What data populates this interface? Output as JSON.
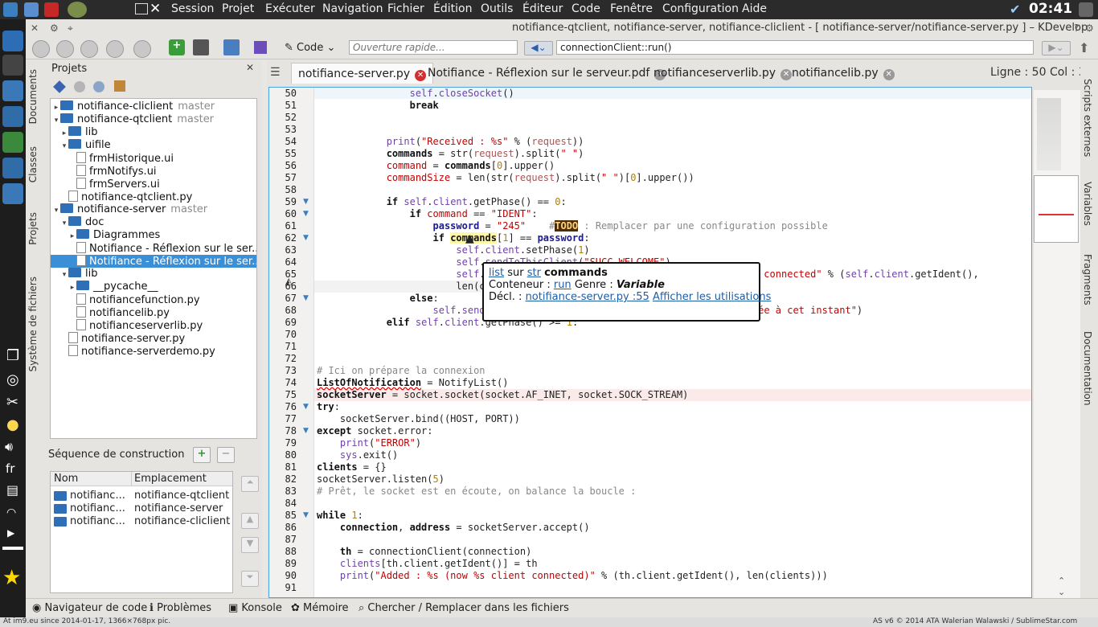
{
  "topbar": {
    "menus": [
      "Session",
      "Projet",
      "Exécuter",
      "Navigation",
      "Fichier",
      "Édition",
      "Outils",
      "Éditeur",
      "Code",
      "Fenêtre",
      "Configuration",
      "Aide"
    ],
    "clock": "02:41"
  },
  "window": {
    "title": "notifiance-qtclient, notifiance-server, notifiance-cliclient - [ notifiance-server/notifiance-server.py ] – KDevelop",
    "code_button": "Code",
    "quick_open_placeholder": "Ouverture rapide...",
    "context": "connectionClient::run()",
    "line_col": "Ligne : 50 Col : 35"
  },
  "left_tabs": [
    "Documents",
    "Classes",
    "Projets",
    "Système de fichiers"
  ],
  "projects": {
    "title": "Projets",
    "tree": [
      {
        "text": "notifiance-cliclient",
        "branch": "master",
        "type": "folder",
        "arrow": "▸",
        "indent": 0
      },
      {
        "text": "notifiance-qtclient",
        "branch": "master",
        "type": "folder",
        "arrow": "▾",
        "indent": 0
      },
      {
        "text": "lib",
        "branch": "",
        "type": "folder",
        "arrow": "▸",
        "indent": 1
      },
      {
        "text": "uifile",
        "branch": "",
        "type": "folder",
        "arrow": "▾",
        "indent": 1
      },
      {
        "text": "frmHistorique.ui",
        "branch": "",
        "type": "file",
        "arrow": "",
        "indent": 2
      },
      {
        "text": "frmNotifys.ui",
        "branch": "",
        "type": "file",
        "arrow": "",
        "indent": 2
      },
      {
        "text": "frmServers.ui",
        "branch": "",
        "type": "file",
        "arrow": "",
        "indent": 2
      },
      {
        "text": "notifiance-qtclient.py",
        "branch": "",
        "type": "file",
        "arrow": "",
        "indent": 1
      },
      {
        "text": "notifiance-server",
        "branch": "master",
        "type": "folder",
        "arrow": "▾",
        "indent": 0
      },
      {
        "text": "doc",
        "branch": "",
        "type": "folder",
        "arrow": "▾",
        "indent": 1
      },
      {
        "text": "Diagrammes",
        "branch": "",
        "type": "folder",
        "arrow": "▸",
        "indent": 2
      },
      {
        "text": "Notifiance - Réflexion sur le ser...",
        "branch": "",
        "type": "file",
        "arrow": "",
        "indent": 2
      },
      {
        "text": "Notifiance - Réflexion sur le ser...",
        "branch": "",
        "type": "file",
        "arrow": "",
        "indent": 2,
        "selected": true
      },
      {
        "text": "lib",
        "branch": "",
        "type": "folder",
        "arrow": "▾",
        "indent": 1
      },
      {
        "text": "__pycache__",
        "branch": "",
        "type": "folder",
        "arrow": "▸",
        "indent": 2
      },
      {
        "text": "notifiancefunction.py",
        "branch": "",
        "type": "file",
        "arrow": "",
        "indent": 2
      },
      {
        "text": "notifiancelib.py",
        "branch": "",
        "type": "file",
        "arrow": "",
        "indent": 2
      },
      {
        "text": "notifianceserverlib.py",
        "branch": "",
        "type": "file",
        "arrow": "",
        "indent": 2
      },
      {
        "text": "notifiance-server.py",
        "branch": "",
        "type": "file",
        "arrow": "",
        "indent": 1
      },
      {
        "text": "notifiance-serverdemo.py",
        "branch": "",
        "type": "file",
        "arrow": "",
        "indent": 1
      }
    ]
  },
  "build": {
    "title": "Séquence de construction",
    "col_name": "Nom",
    "col_location": "Emplacement",
    "rows": [
      {
        "name": "notifianc...",
        "location": "notifiance-qtclient"
      },
      {
        "name": "notifianc...",
        "location": "notifiance-server"
      },
      {
        "name": "notifianc...",
        "location": "notifiance-cliclient"
      }
    ]
  },
  "tabs": [
    {
      "label": "notifiance-server.py",
      "active": true
    },
    {
      "label": "Notifiance - Réflexion sur le serveur.pdf",
      "active": false
    },
    {
      "label": "notifianceserverlib.py",
      "active": false
    },
    {
      "label": "notifiancelib.py",
      "active": false
    }
  ],
  "code_lines": [
    {
      "n": "50",
      "fold": "",
      "html": "                <span class='attr'>self</span>.<span class='attr'>closeSocket</span>()"
    },
    {
      "n": "51",
      "fold": "",
      "html": "                <span class='kw'>break</span>"
    },
    {
      "n": "52",
      "fold": "",
      "html": ""
    },
    {
      "n": "53",
      "fold": "",
      "html": ""
    },
    {
      "n": "54",
      "fold": "",
      "html": "            <span class='attr'>print</span>(<span class='str'>\"Received : %s\"</span> % (<span class='ident'>request</span>))"
    },
    {
      "n": "55",
      "fold": "",
      "html": "            <span class='kw'>commands</span> = str(<span class='ident'>request</span>).split(<span class='str'>\" \"</span>)"
    },
    {
      "n": "56",
      "fold": "",
      "html": "            <span class='str'>command</span> = <span class='kw'>commands</span>[<span class='num'>0</span>].upper()"
    },
    {
      "n": "57",
      "fold": "",
      "html": "            <span class='str'>commandSize</span> = len(str(<span class='ident'>request</span>).split(<span class='str'>\" \"</span>)[<span class='num'>0</span>].upper())"
    },
    {
      "n": "58",
      "fold": "",
      "html": ""
    },
    {
      "n": "59",
      "fold": "▼",
      "html": "            <span class='kw'>if</span> <span class='attr'>self</span>.<span class='attr'>client</span>.getPhase() == <span class='num'>0</span>:"
    },
    {
      "n": "60",
      "fold": "▼",
      "html": "                <span class='kw'>if</span> <span class='str'>command</span> == <span class='str'>\"IDENT\"</span>:"
    },
    {
      "n": "61",
      "fold": "",
      "html": "                    <span class='var'>password</span> = <span class='str'>\"245\"</span>    <span class='cm'>#<b style='background:#4b2e05;color:#ffd27f'>TODO</b> : Remplacer par une configuration possible</span>"
    },
    {
      "n": "62",
      "fold": "▼",
      "html": "                    <span class='kw'>if</span> <span class='kw' style='background:#fff7a8'>commands</span>[<span class='num'>1</span>] == <span class='var'>password</span>:"
    },
    {
      "n": "63",
      "fold": "",
      "html": "                        <span class='attr'>self</span>.<span class='attr'>client</span>.setPhase(<span class='num'>1</span>)"
    },
    {
      "n": "64",
      "fold": "",
      "html": "                        <span class='attr'>self</span>.<span class='attr'>sendToThisClient</span>(<span class='str'>\"SUCC WELCOME\"</span>)"
    },
    {
      "n": "65",
      "fold": "",
      "html": "                        <span class='attr'>self</span>.                                      <span class='str'>client(s) connected\"</span> % (<span class='attr'>self</span>.<span class='attr'>client</span>.getIdent(),"
    },
    {
      "n": "66",
      "fold": "",
      "html": "                        len(c"
    },
    {
      "n": "67",
      "fold": "▼",
      "html": "                <span class='kw'>else</span>:"
    },
    {
      "n": "68",
      "fold": "",
      "html": "                    <span class='attr'>self</span>.<span class='attr'>sendT</span>                                     <span class='str'>n-autorisée à cet instant\"</span>)"
    },
    {
      "n": "69",
      "fold": "",
      "html": "            <span class='kw'>elif</span> <span class='attr'>self</span>.<span class='attr'>client</span>.getPhase() >= <span class='num'>1</span>:"
    },
    {
      "n": "70",
      "fold": "",
      "html": ""
    },
    {
      "n": "71",
      "fold": "",
      "html": ""
    },
    {
      "n": "72",
      "fold": "",
      "html": ""
    },
    {
      "n": "73",
      "fold": "",
      "html": "<span class='cm'># Ici on prépare la connexion</span>"
    },
    {
      "n": "74",
      "fold": "",
      "html": "<span class='kw' style='text-decoration:underline wavy #d00'>ListOfNotification</span> = NotifyList()"
    },
    {
      "n": "75",
      "fold": "",
      "html": "<span class='kw'>socketServer</span> = socket.socket(socket.AF_INET, socket.SOCK_STREAM)"
    },
    {
      "n": "76",
      "fold": "▼",
      "html": "<span class='kw'>try</span>:"
    },
    {
      "n": "77",
      "fold": "",
      "html": "    socketServer.bind((HOST, PORT))"
    },
    {
      "n": "78",
      "fold": "▼",
      "html": "<span class='kw'>except</span> socket.error:"
    },
    {
      "n": "79",
      "fold": "",
      "html": "    <span class='attr'>print</span>(<span class='str'>\"ERROR\"</span>)"
    },
    {
      "n": "80",
      "fold": "",
      "html": "    <span class='attr'>sys</span>.exit()"
    },
    {
      "n": "81",
      "fold": "",
      "html": "<span class='kw'>clients</span> = {}"
    },
    {
      "n": "82",
      "fold": "",
      "html": "socketServer.listen(<span class='num'>5</span>)"
    },
    {
      "n": "83",
      "fold": "",
      "html": "<span class='cm'># Prêt, le socket est en écoute, on balance la boucle :</span>"
    },
    {
      "n": "84",
      "fold": "",
      "html": ""
    },
    {
      "n": "85",
      "fold": "▼",
      "html": "<span class='kw'>while</span> <span class='num'>1</span>:"
    },
    {
      "n": "86",
      "fold": "",
      "html": "    <span class='kw'>connection</span>, <span class='kw'>address</span> = socketServer.accept()"
    },
    {
      "n": "87",
      "fold": "",
      "html": ""
    },
    {
      "n": "88",
      "fold": "",
      "html": "    <span class='kw'>th</span> = connectionClient(connection)"
    },
    {
      "n": "89",
      "fold": "",
      "html": "    <span class='attr'>clients</span>[th.client.getIdent()] = th"
    },
    {
      "n": "90",
      "fold": "",
      "html": "    <span class='attr'>print</span>(<span class='str'>\"Added : %s (now %s client connected)\"</span> % (th.client.getIdent(), len(clients)))"
    },
    {
      "n": "91",
      "fold": "",
      "html": ""
    }
  ],
  "tooltip": {
    "line1_a": "list",
    "line1_mid": "sur",
    "line1_b": "str",
    "line1_name": "commands",
    "line2_label": "Conteneur :",
    "line2_link": "run",
    "line2_genre": "Genre :",
    "line2_kind": "Variable",
    "line3_label": "Décl. :",
    "line3_link": "notifiance-server.py :55",
    "line3_uses": "Afficher les utilisations"
  },
  "right_tabs": [
    "Scripts externes",
    "Variables",
    "Fragments",
    "Documentation"
  ],
  "bottom_tabs": [
    "Navigateur de code",
    "Problèmes",
    "Konsole",
    "Mémoire",
    "Chercher / Remplacer dans les fichiers"
  ],
  "status": {
    "left": "At im9.eu since 2014-01-17, 1366×768px pic.",
    "right": "AS v6 © 2014 ATA Walerian Walawski / SublimeStar.com"
  },
  "colors": {
    "accent": "#3b8fd6",
    "editor_border": "#4aa3e0",
    "folder": "#2f6fb8"
  }
}
